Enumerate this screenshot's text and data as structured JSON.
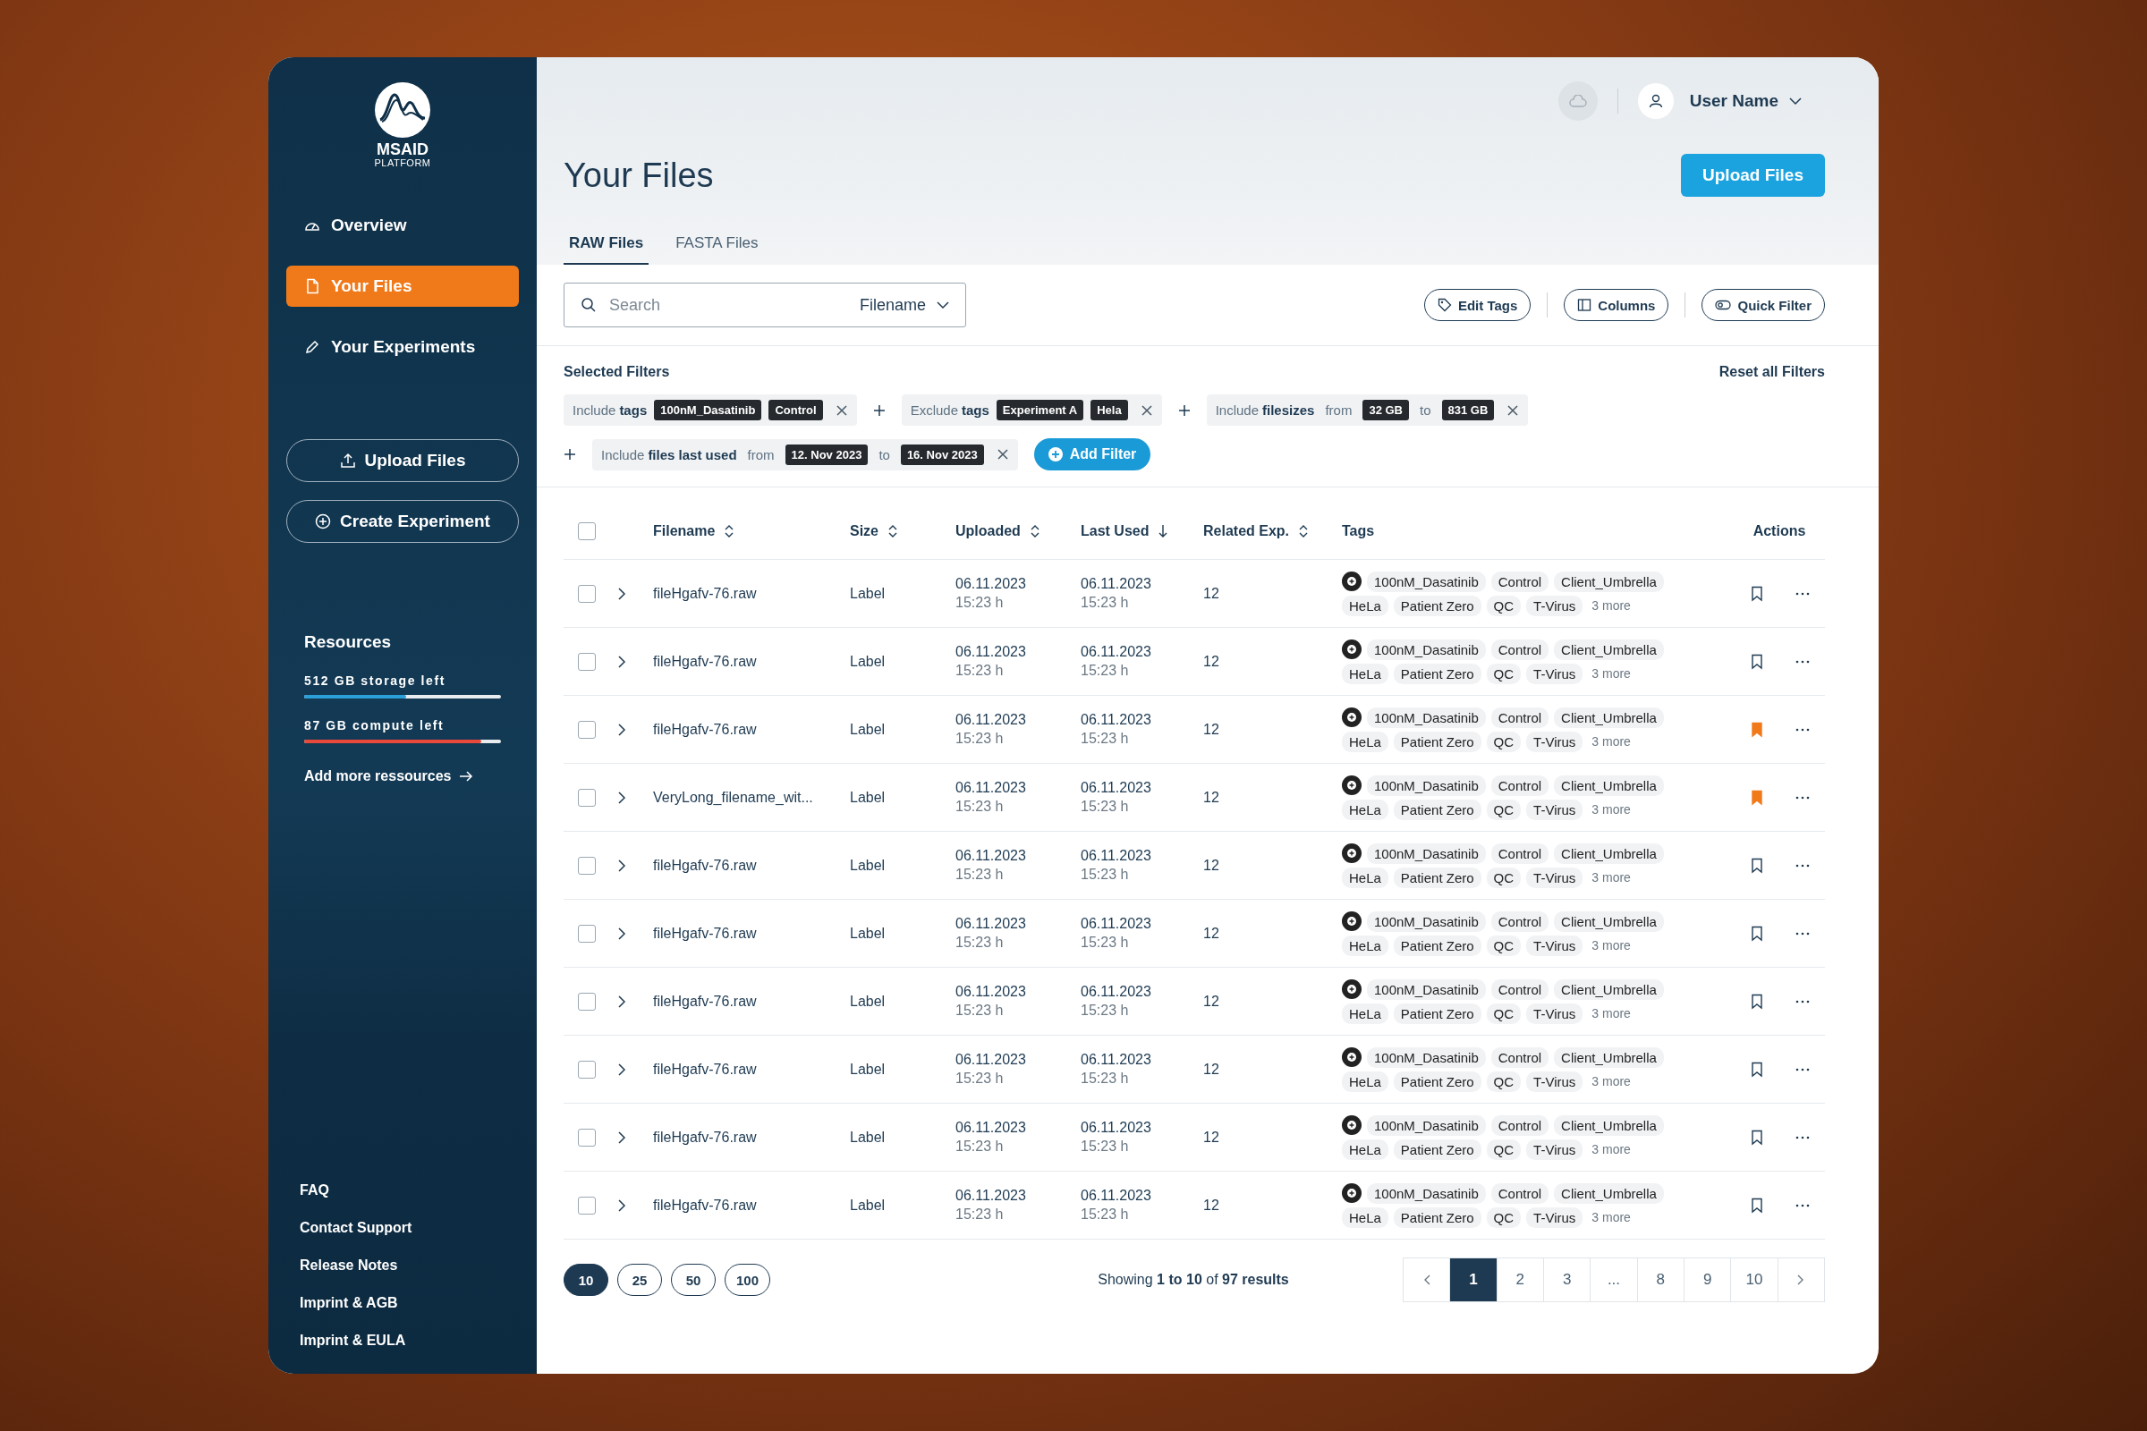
{
  "sidebar": {
    "logo": {
      "name": "MSAID",
      "subtitle": "PLATFORM"
    },
    "nav": [
      {
        "label": "Overview",
        "selected": false
      },
      {
        "label": "Your Files",
        "selected": true
      },
      {
        "label": "Your Experiments",
        "selected": false
      }
    ],
    "actions": [
      "Upload Files",
      "Create Experiment"
    ],
    "resources": {
      "title": "Resources",
      "meters": [
        {
          "label": "512 GB storage left",
          "level": 0.52,
          "color": "#2a9fd8"
        },
        {
          "label": "87 GB compute left",
          "level": 0.9,
          "color": "#e8493a"
        }
      ],
      "link": "Add more ressources"
    },
    "footer_links": [
      "FAQ",
      "Contact Support",
      "Release Notes",
      "Imprint & AGB",
      "Imprint & EULA"
    ]
  },
  "topbar": {
    "user": "User Name"
  },
  "title": "Your Files",
  "upload_button": "Upload Files",
  "tabs": [
    {
      "label": "RAW Files",
      "selected": true
    },
    {
      "label": "FASTA Files",
      "selected": false
    }
  ],
  "search": {
    "placeholder": "Search",
    "scope": "Filename"
  },
  "toolbar": [
    "Edit Tags",
    "Columns",
    "Quick Filter"
  ],
  "filters": {
    "title": "Selected Filters",
    "reset": "Reset all Filters",
    "add": "Add Filter",
    "items": [
      {
        "mode": "Include",
        "subject": "tags",
        "parts": [
          {
            "kind": "chip",
            "text": "100nM_Dasatinib"
          },
          {
            "kind": "chip",
            "text": "Control"
          }
        ]
      },
      {
        "mode": "Exclude",
        "subject": "tags",
        "parts": [
          {
            "kind": "chip",
            "text": "Experiment A"
          },
          {
            "kind": "chip",
            "text": "Hela"
          }
        ]
      },
      {
        "mode": "Include",
        "subject": "filesizes",
        "parts": [
          {
            "kind": "word",
            "text": "from"
          },
          {
            "kind": "chip",
            "text": "32 GB"
          },
          {
            "kind": "word",
            "text": "to"
          },
          {
            "kind": "chip",
            "text": "831 GB"
          }
        ]
      },
      {
        "mode": "Include",
        "subject": "files last used",
        "parts": [
          {
            "kind": "word",
            "text": "from"
          },
          {
            "kind": "chip",
            "text": "12. Nov 2023"
          },
          {
            "kind": "word",
            "text": "to"
          },
          {
            "kind": "chip",
            "text": "16. Nov 2023"
          }
        ]
      }
    ]
  },
  "table": {
    "all_checked": false,
    "columns": [
      {
        "label": "Filename",
        "kind": "sortable"
      },
      {
        "label": "Size",
        "kind": "sortable"
      },
      {
        "label": "Uploaded",
        "kind": "sortable"
      },
      {
        "label": "Last Used",
        "kind": "sorted"
      },
      {
        "label": "Related Exp.",
        "kind": "sortable"
      },
      {
        "label": "Tags",
        "kind": "plain"
      },
      {
        "label": "Actions",
        "kind": "plain"
      }
    ],
    "rows": [
      {
        "checked": false,
        "filename": "fileHgafv-76.raw",
        "size": "Label",
        "uploaded": "06.11.2023",
        "uploaded_time": "15:23 h",
        "last_used": "06.11.2023",
        "last_used_time": "15:23 h",
        "related": "12",
        "tags": [
          "100nM_Dasatinib",
          "Control",
          "Client_Umbrella",
          "HeLa",
          "Patient Zero",
          "QC",
          "T-Virus"
        ],
        "more": "3 more",
        "bookmarked": false
      },
      {
        "checked": false,
        "filename": "fileHgafv-76.raw",
        "size": "Label",
        "uploaded": "06.11.2023",
        "uploaded_time": "15:23 h",
        "last_used": "06.11.2023",
        "last_used_time": "15:23 h",
        "related": "12",
        "tags": [
          "100nM_Dasatinib",
          "Control",
          "Client_Umbrella",
          "HeLa",
          "Patient Zero",
          "QC",
          "T-Virus"
        ],
        "more": "3 more",
        "bookmarked": false
      },
      {
        "checked": false,
        "filename": "fileHgafv-76.raw",
        "size": "Label",
        "uploaded": "06.11.2023",
        "uploaded_time": "15:23 h",
        "last_used": "06.11.2023",
        "last_used_time": "15:23 h",
        "related": "12",
        "tags": [
          "100nM_Dasatinib",
          "Control",
          "Client_Umbrella",
          "HeLa",
          "Patient Zero",
          "QC",
          "T-Virus"
        ],
        "more": "3 more",
        "bookmarked": true
      },
      {
        "checked": false,
        "filename": "VeryLong_filename_wit...",
        "size": "Label",
        "uploaded": "06.11.2023",
        "uploaded_time": "15:23 h",
        "last_used": "06.11.2023",
        "last_used_time": "15:23 h",
        "related": "12",
        "tags": [
          "100nM_Dasatinib",
          "Control",
          "Client_Umbrella",
          "HeLa",
          "Patient Zero",
          "QC",
          "T-Virus"
        ],
        "more": "3 more",
        "bookmarked": true
      },
      {
        "checked": false,
        "filename": "fileHgafv-76.raw",
        "size": "Label",
        "uploaded": "06.11.2023",
        "uploaded_time": "15:23 h",
        "last_used": "06.11.2023",
        "last_used_time": "15:23 h",
        "related": "12",
        "tags": [
          "100nM_Dasatinib",
          "Control",
          "Client_Umbrella",
          "HeLa",
          "Patient Zero",
          "QC",
          "T-Virus"
        ],
        "more": "3 more",
        "bookmarked": false
      },
      {
        "checked": false,
        "filename": "fileHgafv-76.raw",
        "size": "Label",
        "uploaded": "06.11.2023",
        "uploaded_time": "15:23 h",
        "last_used": "06.11.2023",
        "last_used_time": "15:23 h",
        "related": "12",
        "tags": [
          "100nM_Dasatinib",
          "Control",
          "Client_Umbrella",
          "HeLa",
          "Patient Zero",
          "QC",
          "T-Virus"
        ],
        "more": "3 more",
        "bookmarked": false
      },
      {
        "checked": false,
        "filename": "fileHgafv-76.raw",
        "size": "Label",
        "uploaded": "06.11.2023",
        "uploaded_time": "15:23 h",
        "last_used": "06.11.2023",
        "last_used_time": "15:23 h",
        "related": "12",
        "tags": [
          "100nM_Dasatinib",
          "Control",
          "Client_Umbrella",
          "HeLa",
          "Patient Zero",
          "QC",
          "T-Virus"
        ],
        "more": "3 more",
        "bookmarked": false
      },
      {
        "checked": false,
        "filename": "fileHgafv-76.raw",
        "size": "Label",
        "uploaded": "06.11.2023",
        "uploaded_time": "15:23 h",
        "last_used": "06.11.2023",
        "last_used_time": "15:23 h",
        "related": "12",
        "tags": [
          "100nM_Dasatinib",
          "Control",
          "Client_Umbrella",
          "HeLa",
          "Patient Zero",
          "QC",
          "T-Virus"
        ],
        "more": "3 more",
        "bookmarked": false
      },
      {
        "checked": false,
        "filename": "fileHgafv-76.raw",
        "size": "Label",
        "uploaded": "06.11.2023",
        "uploaded_time": "15:23 h",
        "last_used": "06.11.2023",
        "last_used_time": "15:23 h",
        "related": "12",
        "tags": [
          "100nM_Dasatinib",
          "Control",
          "Client_Umbrella",
          "HeLa",
          "Patient Zero",
          "QC",
          "T-Virus"
        ],
        "more": "3 more",
        "bookmarked": false
      },
      {
        "checked": false,
        "filename": "fileHgafv-76.raw",
        "size": "Label",
        "uploaded": "06.11.2023",
        "uploaded_time": "15:23 h",
        "last_used": "06.11.2023",
        "last_used_time": "15:23 h",
        "related": "12",
        "tags": [
          "100nM_Dasatinib",
          "Control",
          "Client_Umbrella",
          "HeLa",
          "Patient Zero",
          "QC",
          "T-Virus"
        ],
        "more": "3 more",
        "bookmarked": false
      }
    ]
  },
  "pagination": {
    "page_sizes": [
      {
        "label": "10",
        "selected": true
      },
      {
        "label": "25",
        "selected": false
      },
      {
        "label": "50",
        "selected": false
      },
      {
        "label": "100",
        "selected": false
      }
    ],
    "summary": "Showing **1 to 10** of **97 results**",
    "pages": [
      {
        "label": "1",
        "selected": true
      },
      {
        "label": "2",
        "selected": false
      },
      {
        "label": "3",
        "selected": false
      },
      {
        "label": "...",
        "selected": false
      },
      {
        "label": "8",
        "selected": false
      },
      {
        "label": "9",
        "selected": false
      },
      {
        "label": "10",
        "selected": false
      }
    ]
  }
}
